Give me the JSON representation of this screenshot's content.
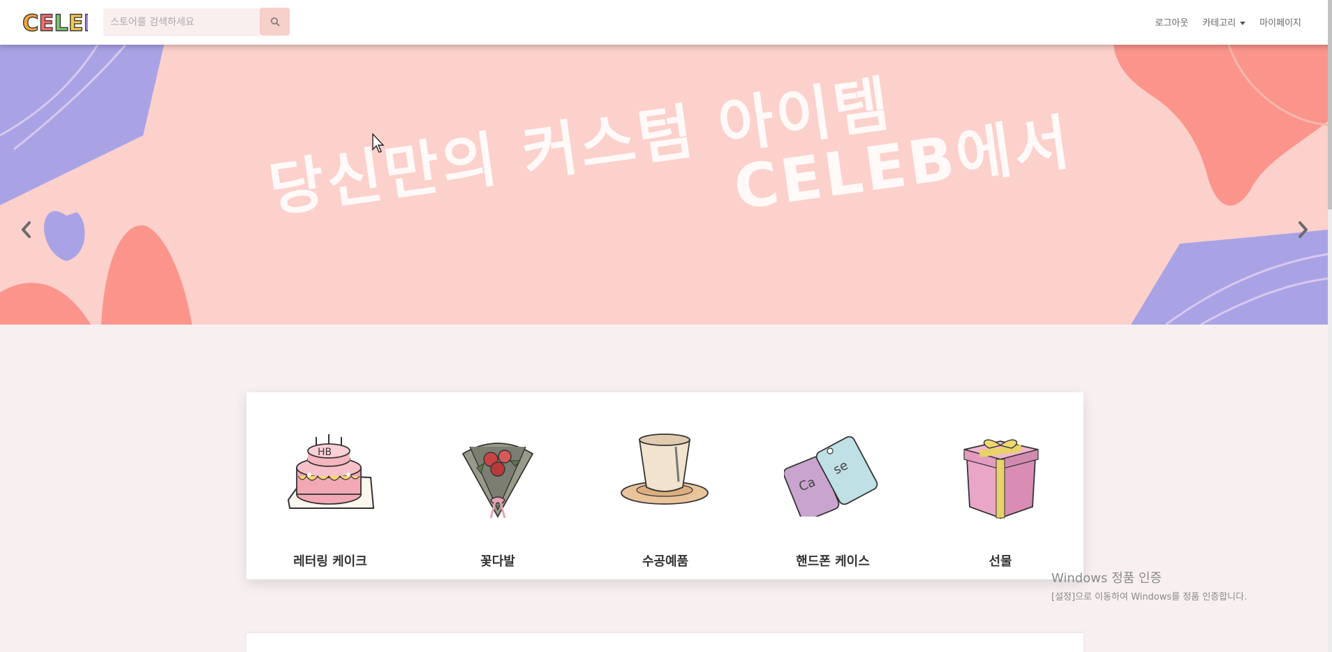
{
  "header": {
    "logo_text": "CELEB",
    "search": {
      "placeholder": "스토어를 검색하세요",
      "value": ""
    },
    "nav": {
      "logout": "로그아웃",
      "category": "카테고리",
      "mypage": "마이페이지"
    }
  },
  "banner": {
    "line1": "당신만의 커스텀 아이템",
    "line2": "CELEB에서"
  },
  "categories": [
    {
      "label": "레터링 케이크",
      "icon": "cake-icon"
    },
    {
      "label": "꽃다발",
      "icon": "bouquet-icon"
    },
    {
      "label": "수공예품",
      "icon": "handmade-cup-icon"
    },
    {
      "label": "핸드폰 케이스",
      "icon": "phone-case-icon"
    },
    {
      "label": "선물",
      "icon": "gift-box-icon"
    }
  ],
  "os_watermark": {
    "title": "Windows 정품 인증",
    "subtitle": "[설정]으로 이동하여 Windows를 정품 인증합니다."
  },
  "colors": {
    "banner_bg": "#fcd0cb",
    "banner_purple": "#a9a3e6",
    "banner_coral": "#fb958b",
    "search_button": "#f7cfcb",
    "page_bg": "#f8f0f0"
  }
}
